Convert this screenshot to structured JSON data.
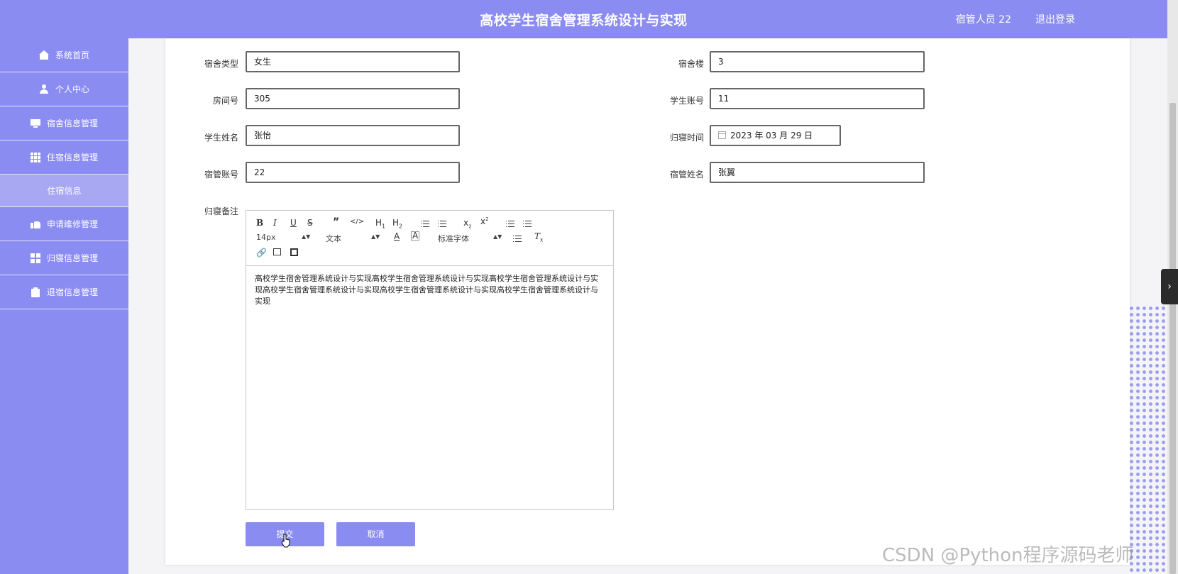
{
  "header": {
    "title": "高校学生宿舍管理系统设计与实现",
    "user": "宿管人员 22",
    "logout": "退出登录"
  },
  "sidebar": {
    "items": [
      {
        "label": "系统首页",
        "icon": "home-icon"
      },
      {
        "label": "个人中心",
        "icon": "user-icon"
      },
      {
        "label": "宿舍信息管理",
        "icon": "monitor-icon"
      },
      {
        "label": "住宿信息管理",
        "icon": "grid-icon"
      },
      {
        "label": "住宿信息",
        "sub": true
      },
      {
        "label": "申请维修管理",
        "icon": "thumbs-up-icon"
      },
      {
        "label": "归寝信息管理",
        "icon": "grid4-icon"
      },
      {
        "label": "退宿信息管理",
        "icon": "clipboard-icon"
      }
    ]
  },
  "form": {
    "dorm_type_label": "宿舍类型",
    "dorm_type_value": "女生",
    "building_label": "宿舍楼",
    "building_value": "3",
    "room_label": "房间号",
    "room_value": "305",
    "student_account_label": "学生账号",
    "student_account_value": "11",
    "student_name_label": "学生姓名",
    "student_name_value": "张怡",
    "return_time_label": "归寝时间",
    "return_time_value": "2023 年 03 月 29 日",
    "manager_account_label": "宿管账号",
    "manager_account_value": "22",
    "manager_name_label": "宿管姓名",
    "manager_name_value": "张翼",
    "remark_label": "归寝备注"
  },
  "editor": {
    "font_size": "14px",
    "block_type": "文本",
    "font_family": "标准字体",
    "content": "高校学生宿舍管理系统设计与实现高校学生宿舍管理系统设计与实现高校学生宿舍管理系统设计与实现高校学生宿舍管理系统设计与实现高校学生宿舍管理系统设计与实现高校学生宿舍管理系统设计与实现"
  },
  "buttons": {
    "submit": "提交",
    "cancel": "取消"
  },
  "watermark": "CSDN @Python程序源码老师",
  "colors": {
    "accent": "#8b8cf2",
    "sub_active": "#a7a8f1"
  }
}
